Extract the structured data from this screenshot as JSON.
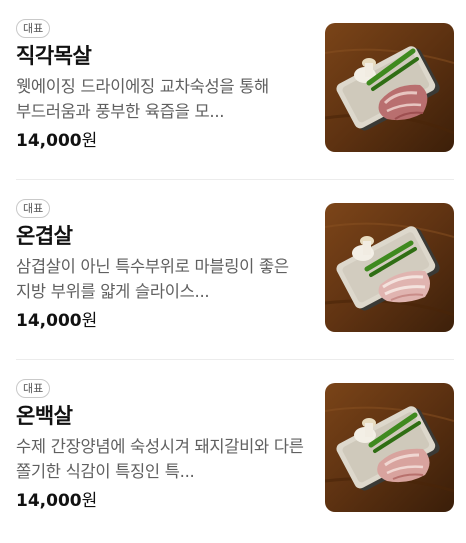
{
  "menu": {
    "items": [
      {
        "badge": "대표",
        "name": "직각목살",
        "description": "웻에이징 드라이에징 교차숙성을 통해 부드러움과 풍부한 육즙을 모...",
        "price_amount": "14,000",
        "price_unit": "원"
      },
      {
        "badge": "대표",
        "name": "온겹살",
        "description": "삼겹살이 아닌 특수부위로 마블링이 좋은 지방 부위를 얇게 슬라이스...",
        "price_amount": "14,000",
        "price_unit": "원"
      },
      {
        "badge": "대표",
        "name": "온백살",
        "description": "수제 간장양념에 숙성시겨 돼지갈비와 다른 쫄기한 식감이 특징인 특...",
        "price_amount": "14,000",
        "price_unit": "원"
      }
    ]
  },
  "colors": {
    "wood_table": "#6b3a14",
    "plate": "#d9d4c8",
    "pork_meat": "#c9898a",
    "green_pepper": "#3f8a1f"
  }
}
